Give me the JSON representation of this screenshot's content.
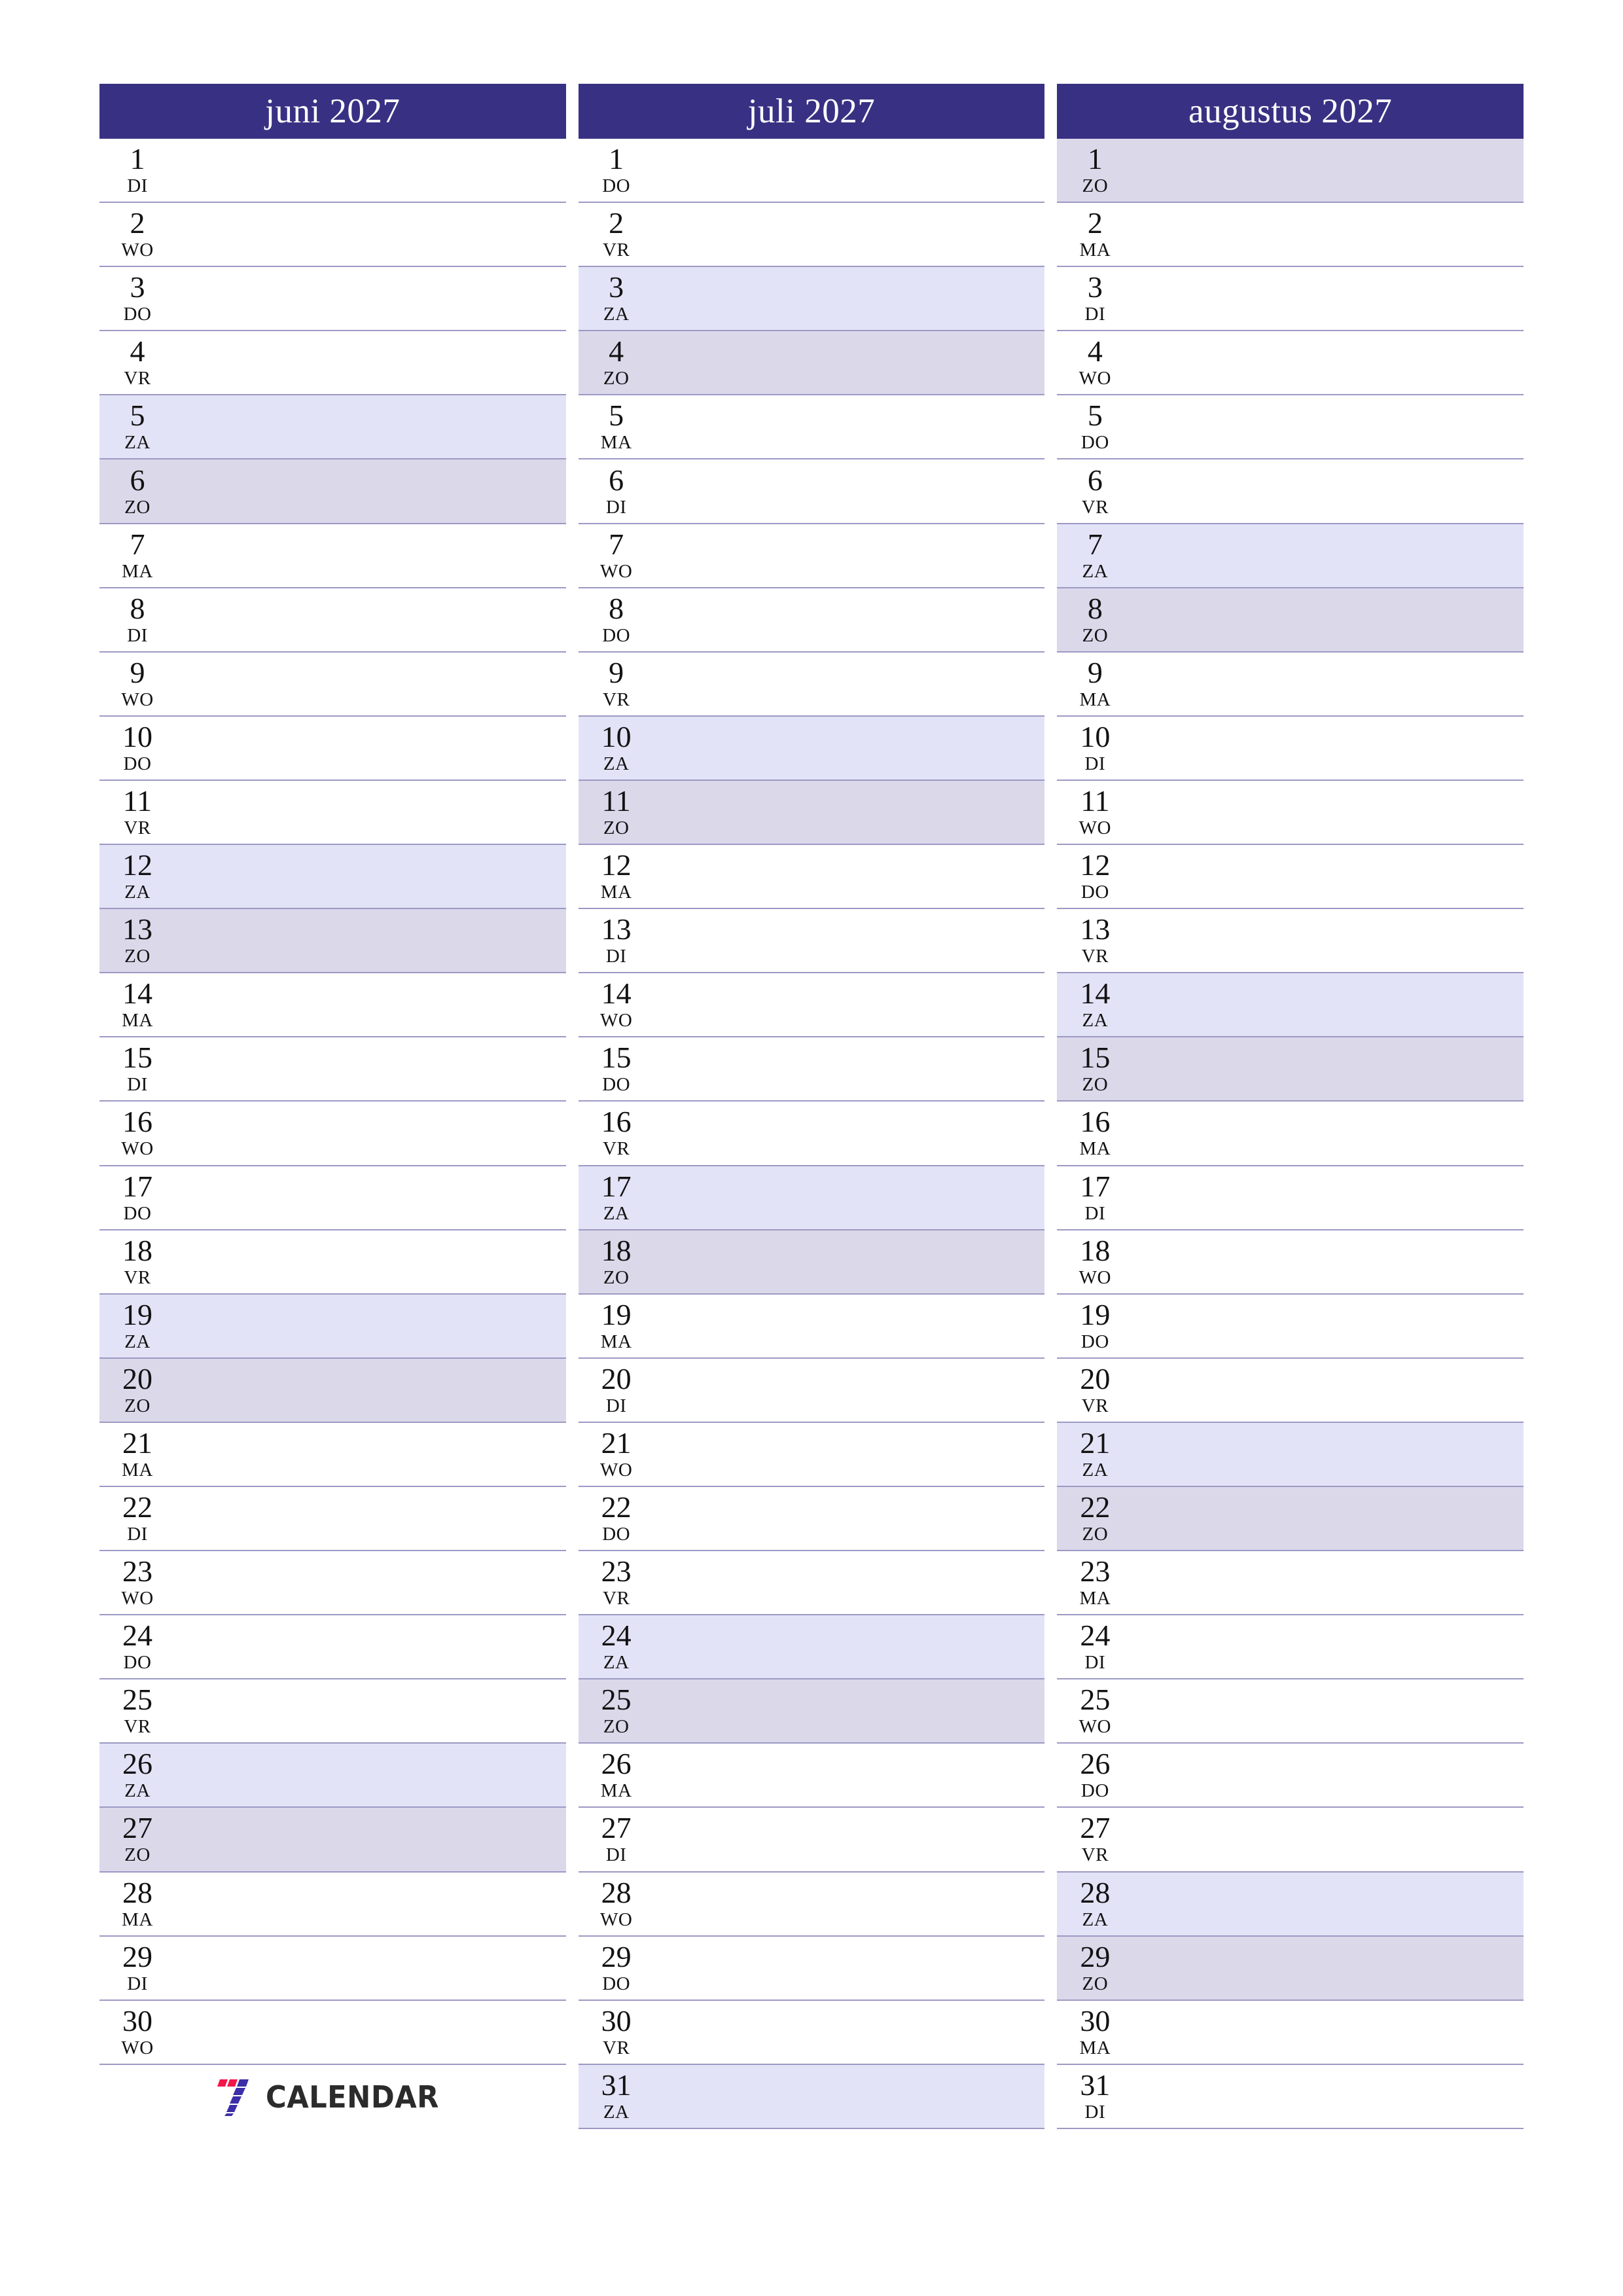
{
  "page": {
    "language": "nl",
    "colors": {
      "header_bg": "#383183",
      "header_text": "#ffffff",
      "row_border": "#9c99c4",
      "saturday_bg": "#e3e3f7",
      "sunday_bg": "#dbd8ea",
      "day_text": "#121212",
      "logo_red": "#f3164a",
      "logo_blue": "#3b2ea8",
      "logo_text": "#2b2b2b"
    }
  },
  "logo": {
    "mark_name": "seven-logo-mark",
    "text": "CALENDAR"
  },
  "months": [
    {
      "title": "juni 2027",
      "days": [
        {
          "num": "1",
          "wd": "DI",
          "type": "weekday"
        },
        {
          "num": "2",
          "wd": "WO",
          "type": "weekday"
        },
        {
          "num": "3",
          "wd": "DO",
          "type": "weekday"
        },
        {
          "num": "4",
          "wd": "VR",
          "type": "weekday"
        },
        {
          "num": "5",
          "wd": "ZA",
          "type": "sat"
        },
        {
          "num": "6",
          "wd": "ZO",
          "type": "sun"
        },
        {
          "num": "7",
          "wd": "MA",
          "type": "weekday"
        },
        {
          "num": "8",
          "wd": "DI",
          "type": "weekday"
        },
        {
          "num": "9",
          "wd": "WO",
          "type": "weekday"
        },
        {
          "num": "10",
          "wd": "DO",
          "type": "weekday"
        },
        {
          "num": "11",
          "wd": "VR",
          "type": "weekday"
        },
        {
          "num": "12",
          "wd": "ZA",
          "type": "sat"
        },
        {
          "num": "13",
          "wd": "ZO",
          "type": "sun"
        },
        {
          "num": "14",
          "wd": "MA",
          "type": "weekday"
        },
        {
          "num": "15",
          "wd": "DI",
          "type": "weekday"
        },
        {
          "num": "16",
          "wd": "WO",
          "type": "weekday"
        },
        {
          "num": "17",
          "wd": "DO",
          "type": "weekday"
        },
        {
          "num": "18",
          "wd": "VR",
          "type": "weekday"
        },
        {
          "num": "19",
          "wd": "ZA",
          "type": "sat"
        },
        {
          "num": "20",
          "wd": "ZO",
          "type": "sun"
        },
        {
          "num": "21",
          "wd": "MA",
          "type": "weekday"
        },
        {
          "num": "22",
          "wd": "DI",
          "type": "weekday"
        },
        {
          "num": "23",
          "wd": "WO",
          "type": "weekday"
        },
        {
          "num": "24",
          "wd": "DO",
          "type": "weekday"
        },
        {
          "num": "25",
          "wd": "VR",
          "type": "weekday"
        },
        {
          "num": "26",
          "wd": "ZA",
          "type": "sat"
        },
        {
          "num": "27",
          "wd": "ZO",
          "type": "sun"
        },
        {
          "num": "28",
          "wd": "MA",
          "type": "weekday"
        },
        {
          "num": "29",
          "wd": "DI",
          "type": "weekday"
        },
        {
          "num": "30",
          "wd": "WO",
          "type": "weekday"
        }
      ],
      "trailing_blank_rows": 1,
      "has_logo": true
    },
    {
      "title": "juli 2027",
      "days": [
        {
          "num": "1",
          "wd": "DO",
          "type": "weekday"
        },
        {
          "num": "2",
          "wd": "VR",
          "type": "weekday"
        },
        {
          "num": "3",
          "wd": "ZA",
          "type": "sat"
        },
        {
          "num": "4",
          "wd": "ZO",
          "type": "sun"
        },
        {
          "num": "5",
          "wd": "MA",
          "type": "weekday"
        },
        {
          "num": "6",
          "wd": "DI",
          "type": "weekday"
        },
        {
          "num": "7",
          "wd": "WO",
          "type": "weekday"
        },
        {
          "num": "8",
          "wd": "DO",
          "type": "weekday"
        },
        {
          "num": "9",
          "wd": "VR",
          "type": "weekday"
        },
        {
          "num": "10",
          "wd": "ZA",
          "type": "sat"
        },
        {
          "num": "11",
          "wd": "ZO",
          "type": "sun"
        },
        {
          "num": "12",
          "wd": "MA",
          "type": "weekday"
        },
        {
          "num": "13",
          "wd": "DI",
          "type": "weekday"
        },
        {
          "num": "14",
          "wd": "WO",
          "type": "weekday"
        },
        {
          "num": "15",
          "wd": "DO",
          "type": "weekday"
        },
        {
          "num": "16",
          "wd": "VR",
          "type": "weekday"
        },
        {
          "num": "17",
          "wd": "ZA",
          "type": "sat"
        },
        {
          "num": "18",
          "wd": "ZO",
          "type": "sun"
        },
        {
          "num": "19",
          "wd": "MA",
          "type": "weekday"
        },
        {
          "num": "20",
          "wd": "DI",
          "type": "weekday"
        },
        {
          "num": "21",
          "wd": "WO",
          "type": "weekday"
        },
        {
          "num": "22",
          "wd": "DO",
          "type": "weekday"
        },
        {
          "num": "23",
          "wd": "VR",
          "type": "weekday"
        },
        {
          "num": "24",
          "wd": "ZA",
          "type": "sat"
        },
        {
          "num": "25",
          "wd": "ZO",
          "type": "sun"
        },
        {
          "num": "26",
          "wd": "MA",
          "type": "weekday"
        },
        {
          "num": "27",
          "wd": "DI",
          "type": "weekday"
        },
        {
          "num": "28",
          "wd": "WO",
          "type": "weekday"
        },
        {
          "num": "29",
          "wd": "DO",
          "type": "weekday"
        },
        {
          "num": "30",
          "wd": "VR",
          "type": "weekday"
        },
        {
          "num": "31",
          "wd": "ZA",
          "type": "sat"
        }
      ],
      "trailing_blank_rows": 0,
      "has_logo": false
    },
    {
      "title": "augustus 2027",
      "days": [
        {
          "num": "1",
          "wd": "ZO",
          "type": "sun"
        },
        {
          "num": "2",
          "wd": "MA",
          "type": "weekday"
        },
        {
          "num": "3",
          "wd": "DI",
          "type": "weekday"
        },
        {
          "num": "4",
          "wd": "WO",
          "type": "weekday"
        },
        {
          "num": "5",
          "wd": "DO",
          "type": "weekday"
        },
        {
          "num": "6",
          "wd": "VR",
          "type": "weekday"
        },
        {
          "num": "7",
          "wd": "ZA",
          "type": "sat"
        },
        {
          "num": "8",
          "wd": "ZO",
          "type": "sun"
        },
        {
          "num": "9",
          "wd": "MA",
          "type": "weekday"
        },
        {
          "num": "10",
          "wd": "DI",
          "type": "weekday"
        },
        {
          "num": "11",
          "wd": "WO",
          "type": "weekday"
        },
        {
          "num": "12",
          "wd": "DO",
          "type": "weekday"
        },
        {
          "num": "13",
          "wd": "VR",
          "type": "weekday"
        },
        {
          "num": "14",
          "wd": "ZA",
          "type": "sat"
        },
        {
          "num": "15",
          "wd": "ZO",
          "type": "sun"
        },
        {
          "num": "16",
          "wd": "MA",
          "type": "weekday"
        },
        {
          "num": "17",
          "wd": "DI",
          "type": "weekday"
        },
        {
          "num": "18",
          "wd": "WO",
          "type": "weekday"
        },
        {
          "num": "19",
          "wd": "DO",
          "type": "weekday"
        },
        {
          "num": "20",
          "wd": "VR",
          "type": "weekday"
        },
        {
          "num": "21",
          "wd": "ZA",
          "type": "sat"
        },
        {
          "num": "22",
          "wd": "ZO",
          "type": "sun"
        },
        {
          "num": "23",
          "wd": "MA",
          "type": "weekday"
        },
        {
          "num": "24",
          "wd": "DI",
          "type": "weekday"
        },
        {
          "num": "25",
          "wd": "WO",
          "type": "weekday"
        },
        {
          "num": "26",
          "wd": "DO",
          "type": "weekday"
        },
        {
          "num": "27",
          "wd": "VR",
          "type": "weekday"
        },
        {
          "num": "28",
          "wd": "ZA",
          "type": "sat"
        },
        {
          "num": "29",
          "wd": "ZO",
          "type": "sun"
        },
        {
          "num": "30",
          "wd": "MA",
          "type": "weekday"
        },
        {
          "num": "31",
          "wd": "DI",
          "type": "weekday"
        }
      ],
      "trailing_blank_rows": 0,
      "has_logo": false
    }
  ]
}
